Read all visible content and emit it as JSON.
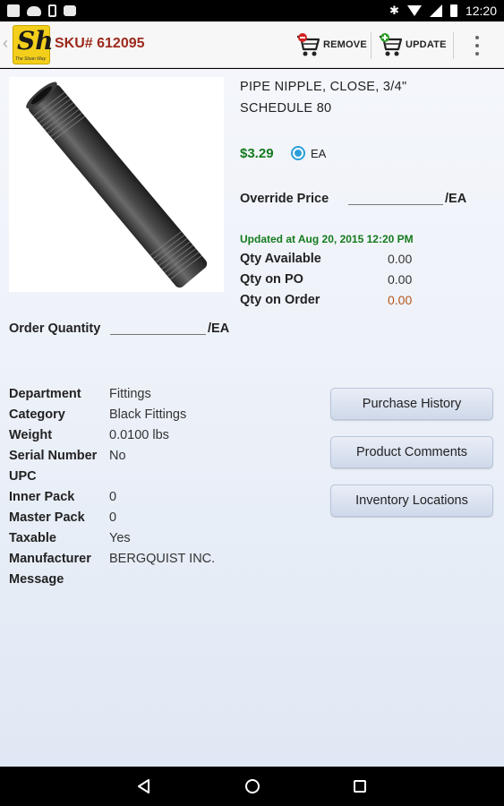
{
  "status_bar": {
    "time": "12:20"
  },
  "app_bar": {
    "logo_text": "Sh",
    "logo_subtext": "The Sloan Way",
    "sku": "SKU# 612095",
    "remove_label": "REMOVE",
    "update_label": "UPDATE",
    "icons": [
      "chevron-left-icon",
      "cart-remove-icon",
      "cart-add-icon",
      "overflow-menu-icon"
    ]
  },
  "product": {
    "title_line1": "PIPE NIPPLE, CLOSE, 3/4\"",
    "title_line2": "SCHEDULE 80",
    "price": "$3.29",
    "unit_option": "EA",
    "override_price_label": "Override Price",
    "override_price_unit": "/EA",
    "updated": "Updated at Aug 20, 2015 12:20 PM",
    "qty_available_label": "Qty Available",
    "qty_available": "0.00",
    "qty_on_po_label": "Qty on PO",
    "qty_on_po": "0.00",
    "qty_on_order_label": "Qty on Order",
    "qty_on_order": "0.00",
    "order_quantity_label": "Order Quantity",
    "order_quantity_unit": "/EA"
  },
  "attributes": [
    {
      "label": "Department",
      "value": "Fittings"
    },
    {
      "label": "Category",
      "value": "Black Fittings"
    },
    {
      "label": "Weight",
      "value": "0.0100 lbs"
    },
    {
      "label": "Serial Number",
      "value": "No"
    },
    {
      "label": "UPC",
      "value": ""
    },
    {
      "label": "Inner Pack",
      "value": "0"
    },
    {
      "label": "Master Pack",
      "value": "0"
    },
    {
      "label": "Taxable",
      "value": "Yes"
    },
    {
      "label": "Manufacturer",
      "value": "BERGQUIST INC."
    },
    {
      "label": "Message",
      "value": ""
    }
  ],
  "buttons": {
    "purchase_history": "Purchase History",
    "product_comments": "Product Comments",
    "inventory_locations": "Inventory Locations"
  },
  "colors": {
    "sku": "#9c2a1c",
    "price": "#157a1e",
    "qty_on_order": "#b4541a",
    "radio": "#2c9fd8"
  }
}
